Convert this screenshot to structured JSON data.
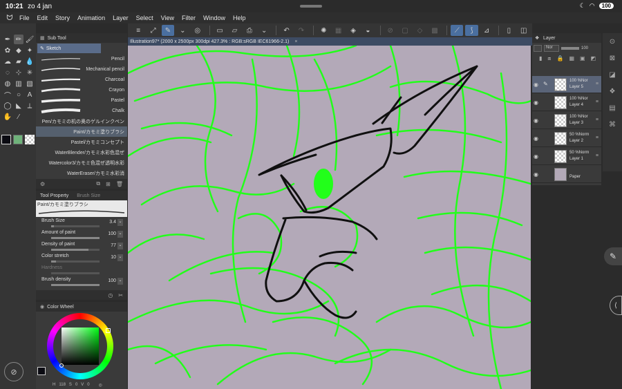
{
  "status": {
    "time": "10:21",
    "date": "zo 4 jan",
    "battery": "100"
  },
  "menu": [
    "File",
    "Edit",
    "Story",
    "Animation",
    "Layer",
    "Select",
    "View",
    "Filter",
    "Window",
    "Help"
  ],
  "subtool": {
    "title": "Sub Tool",
    "group": "Sketch",
    "brushes": [
      "Pencil",
      "Mechanical pencil",
      "Charcoal",
      "Crayon",
      "Pastel",
      "Chalk",
      "Pen/カモミの机の奥のゲルインクペン",
      "Paint/カモミ塗りブラシ",
      "Pastel/カモミコンセプト",
      "WaterBlender/カモミ水彩色混ぜ",
      "Watercolor3/カモミ色混ぜ透明水彩",
      "WaterEraser/カモミ水彩消"
    ]
  },
  "toolprop": {
    "tab1": "Tool Property",
    "tab2": "Brush Size",
    "preset": "Paint/カモミ塗りブラシ",
    "props": [
      {
        "label": "Brush Size",
        "value": "3.4",
        "fill": 0.05
      },
      {
        "label": "Amount of paint",
        "value": "100",
        "fill": 1.0
      },
      {
        "label": "Density of paint",
        "value": "77",
        "fill": 0.77
      },
      {
        "label": "Color stretch",
        "value": "10",
        "fill": 0.1
      },
      {
        "label": "Hardness",
        "value": "",
        "fill": 0
      },
      {
        "label": "Brush density",
        "value": "100",
        "fill": 1.0
      }
    ]
  },
  "colorwheel": {
    "title": "Color Wheel",
    "h": "118",
    "s": "0",
    "v": "0"
  },
  "document": {
    "tab": "Illustration97* (2000 x 2500px 300dpi 427.3% : RGB:sRGB IEC61966-2.1)",
    "close": "×"
  },
  "layer": {
    "title": "Layer",
    "blend": "Nor",
    "opacity": "100",
    "layers": [
      {
        "opacity": "100 %Nor",
        "name": "Layer 5",
        "selected": true
      },
      {
        "opacity": "100 %Nor",
        "name": "Layer 4",
        "selected": false
      },
      {
        "opacity": "100 %Nor",
        "name": "Layer 3",
        "selected": false
      },
      {
        "opacity": "50 %Norm",
        "name": "Layer 2",
        "selected": false
      },
      {
        "opacity": "50 %Norm",
        "name": "Layer 1",
        "selected": false
      },
      {
        "opacity": "",
        "name": "Paper",
        "selected": false
      }
    ]
  },
  "colors": {
    "main": "#0b0b12",
    "sub": "#6fb27a",
    "green_sketch": "#22ff1a",
    "canvas": "#b3a9b8",
    "accent": "#4a6fa0"
  }
}
